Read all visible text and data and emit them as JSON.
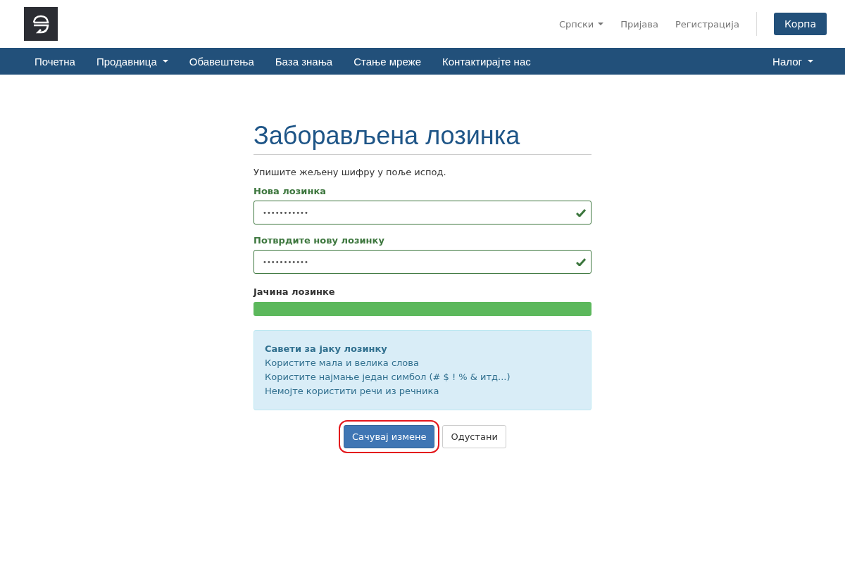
{
  "header": {
    "language": {
      "label": "Српски",
      "has_caret": true
    },
    "links": [
      "Пријава",
      "Регистрација"
    ],
    "cart_button": "Корпа"
  },
  "nav": {
    "items": [
      {
        "label": "Почетна",
        "has_caret": false
      },
      {
        "label": "Продавница",
        "has_caret": true
      },
      {
        "label": "Обавештења",
        "has_caret": false
      },
      {
        "label": "База знања",
        "has_caret": false
      },
      {
        "label": "Стање мреже",
        "has_caret": false
      },
      {
        "label": "Контактирајте нас",
        "has_caret": false
      }
    ],
    "account": {
      "label": "Налог",
      "has_caret": true
    }
  },
  "page": {
    "title": "Заборављена лозинка",
    "intro": "Упишите жељену шифру у поље испод.",
    "fields": [
      {
        "label": "Нова лозинка",
        "value": "•••••••••••",
        "valid": true
      },
      {
        "label": "Потврдите нову лозинку",
        "value": "•••••••••••",
        "valid": true
      }
    ],
    "strength": {
      "label": "Јачина лозинке",
      "level": 1
    },
    "tips": {
      "title": "Савети за јаку лозинку",
      "lines": [
        "Користите мала и велика слова",
        "Користите најмање један симбол (# $ ! % & итд...)",
        "Немојте користити речи из речника"
      ]
    },
    "buttons": [
      {
        "label": "Сачувај измене",
        "kind": "primary",
        "highlighted": true
      },
      {
        "label": "Одустани",
        "kind": "default",
        "highlighted": false
      }
    ]
  }
}
